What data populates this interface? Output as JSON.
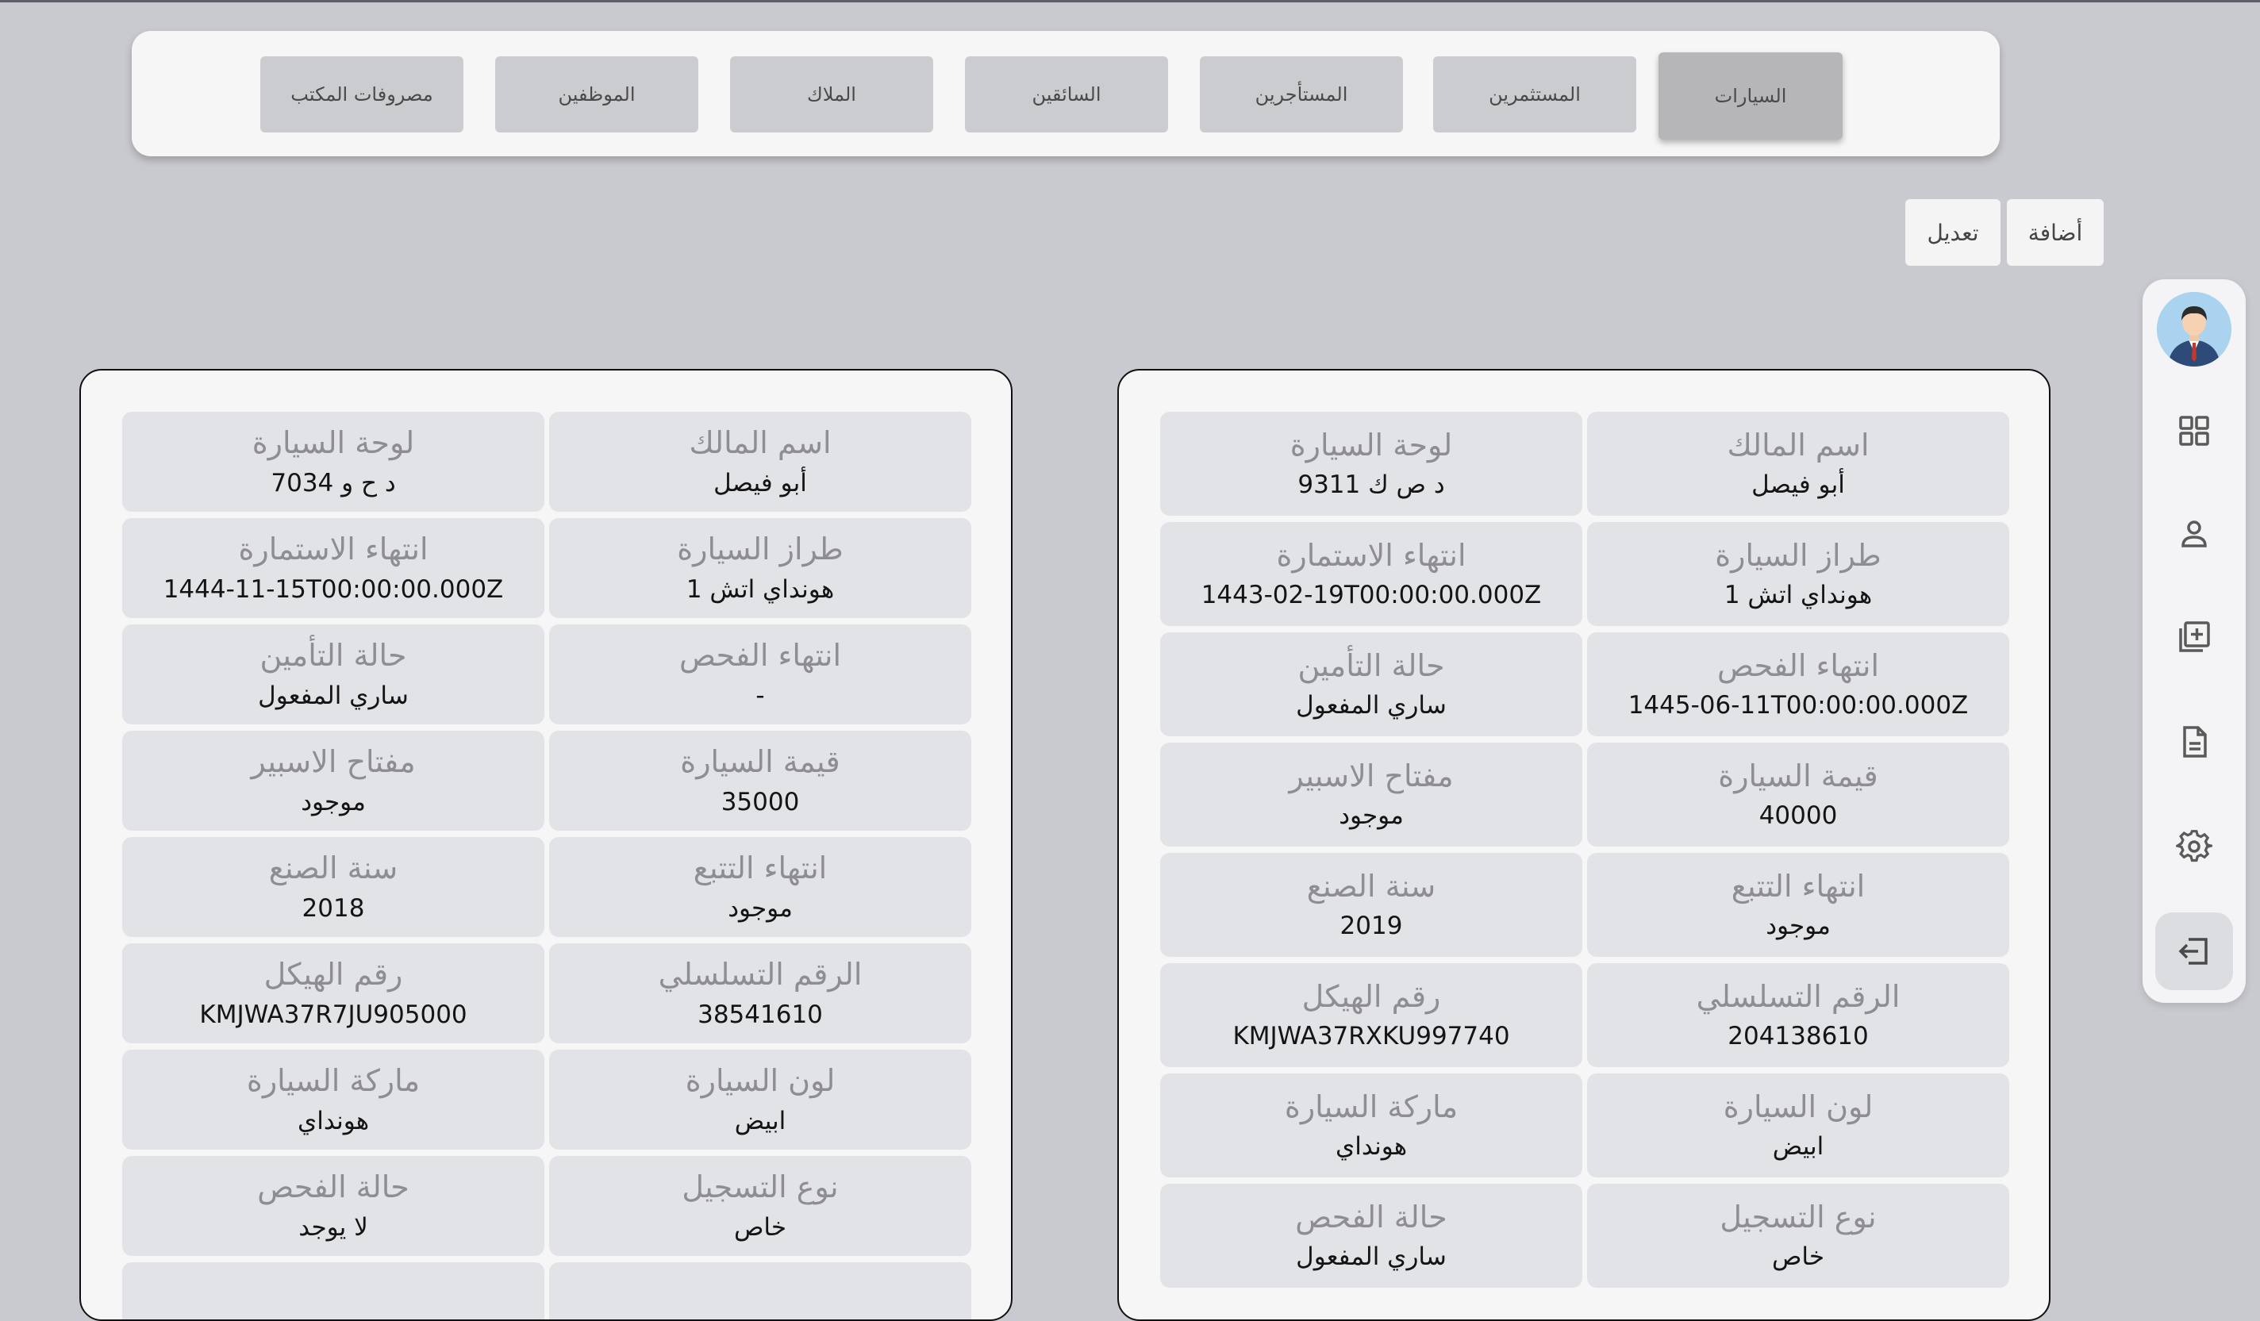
{
  "nav": {
    "tabs": [
      {
        "label": "السيارات",
        "active": true
      },
      {
        "label": "المستثمرين",
        "active": false
      },
      {
        "label": "المستأجرين",
        "active": false
      },
      {
        "label": "السائقين",
        "active": false
      },
      {
        "label": "الملاك",
        "active": false
      },
      {
        "label": "الموظفين",
        "active": false
      },
      {
        "label": "مصروفات المكتب",
        "active": false
      }
    ]
  },
  "actions": {
    "add_label": "أضافة",
    "edit_label": "تعديل"
  },
  "sidebar": {
    "items": [
      {
        "icon": "avatar"
      },
      {
        "icon": "dashboard-grid-icon"
      },
      {
        "icon": "user-icon"
      },
      {
        "icon": "add-library-icon"
      },
      {
        "icon": "document-icon"
      },
      {
        "icon": "gear-icon"
      },
      {
        "icon": "logout-icon"
      }
    ]
  },
  "cards": [
    {
      "cells": [
        {
          "label": "اسم المالك",
          "value": "أبو فيصل"
        },
        {
          "label": "لوحة السيارة",
          "value": "د ص ك 9311"
        },
        {
          "label": "طراز السيارة",
          "value": "هونداي اتش 1"
        },
        {
          "label": "انتهاء الاستمارة",
          "value": "1443-02-19T00:00:00.000Z"
        },
        {
          "label": "انتهاء الفحص",
          "value": "1445-06-11T00:00:00.000Z"
        },
        {
          "label": "حالة التأمين",
          "value": "ساري المفعول"
        },
        {
          "label": "قيمة السيارة",
          "value": "40000"
        },
        {
          "label": "مفتاح الاسبير",
          "value": "موجود"
        },
        {
          "label": "انتهاء التتبع",
          "value": "موجود"
        },
        {
          "label": "سنة الصنع",
          "value": "2019"
        },
        {
          "label": "الرقم التسلسلي",
          "value": "204138610"
        },
        {
          "label": "رقم الهيكل",
          "value": "KMJWA37RXKU997740"
        },
        {
          "label": "لون السيارة",
          "value": "ابيض"
        },
        {
          "label": "ماركة السيارة",
          "value": "هونداي"
        },
        {
          "label": "نوع التسجيل",
          "value": "خاص"
        },
        {
          "label": "حالة الفحص",
          "value": "ساري المفعول"
        }
      ]
    },
    {
      "cells": [
        {
          "label": "اسم المالك",
          "value": "أبو فيصل"
        },
        {
          "label": "لوحة السيارة",
          "value": "د ح و 7034"
        },
        {
          "label": "طراز السيارة",
          "value": "هونداي اتش 1"
        },
        {
          "label": "انتهاء الاستمارة",
          "value": "1444-11-15T00:00:00.000Z"
        },
        {
          "label": "انتهاء الفحص",
          "value": "-"
        },
        {
          "label": "حالة التأمين",
          "value": "ساري المفعول"
        },
        {
          "label": "قيمة السيارة",
          "value": "35000"
        },
        {
          "label": "مفتاح الاسبير",
          "value": "موجود"
        },
        {
          "label": "انتهاء التتبع",
          "value": "موجود"
        },
        {
          "label": "سنة الصنع",
          "value": "2018"
        },
        {
          "label": "الرقم التسلسلي",
          "value": "38541610"
        },
        {
          "label": "رقم الهيكل",
          "value": "KMJWA37R7JU905000"
        },
        {
          "label": "لون السيارة",
          "value": "ابيض"
        },
        {
          "label": "ماركة السيارة",
          "value": "هونداي"
        },
        {
          "label": "نوع التسجيل",
          "value": "خاص"
        },
        {
          "label": "حالة الفحص",
          "value": "لا يوجد"
        }
      ]
    }
  ]
}
